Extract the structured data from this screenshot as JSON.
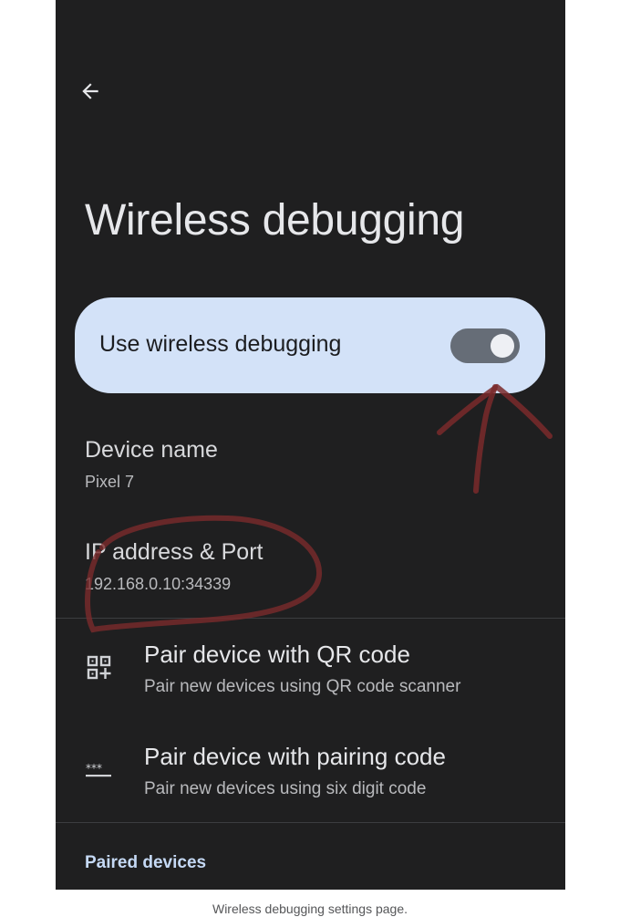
{
  "header": {
    "back_icon": "arrow-back-icon",
    "title": "Wireless debugging"
  },
  "main_toggle": {
    "label": "Use wireless debugging",
    "state": "on",
    "card_color": "#d3e2f8"
  },
  "device_name": {
    "title": "Device name",
    "value": "Pixel 7"
  },
  "ip_port": {
    "title": "IP address & Port",
    "value": "192.168.0.10:34339"
  },
  "pair_options": [
    {
      "icon": "qr-code-add-icon",
      "title": "Pair device with QR code",
      "subtitle": "Pair new devices using QR code scanner"
    },
    {
      "icon": "pin-dots-icon",
      "title": "Pair device with pairing code",
      "subtitle": "Pair new devices using six digit code"
    }
  ],
  "paired_devices": {
    "header": "Paired devices"
  },
  "caption": "Wireless debugging settings page.",
  "colors": {
    "background": "#1f1f20",
    "accent_header": "#c5d9f5",
    "annotation_marker": "#7a2a2c"
  }
}
